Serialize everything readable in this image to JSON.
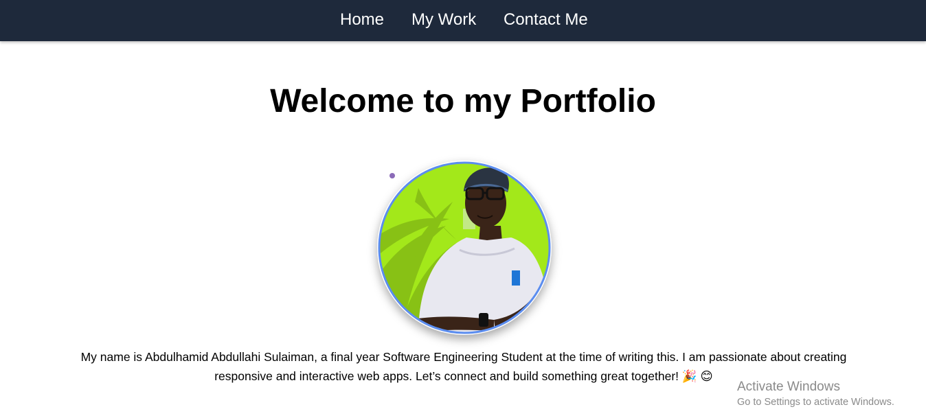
{
  "nav": {
    "home": "Home",
    "work": "My Work",
    "contact": "Contact Me"
  },
  "hero": {
    "title": "Welcome to my Portfolio",
    "bio": "My name is Abdulhamid Abdullahi Sulaiman, a final year Software Engineering Student at the time of writing this. I am passionate about creating responsive and interactive web apps. Let’s connect and build something great together! 🎉 😊"
  },
  "colors": {
    "navbar": "#1e293b",
    "avatar_ring": "#5b8def",
    "avatar_background": "#a3e81a",
    "dot": "#8b6bb8"
  },
  "watermark": {
    "title": "Activate Windows",
    "subtitle": "Go to Settings to activate Windows."
  }
}
